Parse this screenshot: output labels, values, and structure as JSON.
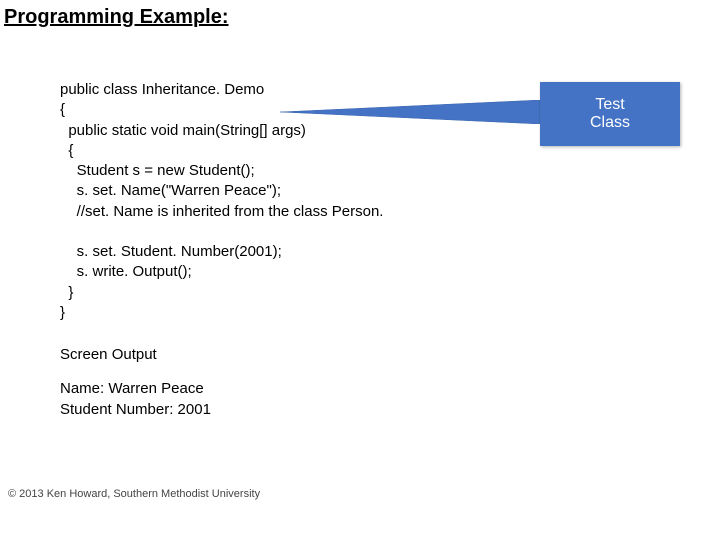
{
  "title": "Programming Example:",
  "code": {
    "l1": "public class Inheritance. Demo",
    "l2": "{",
    "l3": "  public static void main(String[] args)",
    "l4": "  {",
    "l5": "    Student s = new Student();",
    "l6": "    s. set. Name(\"Warren Peace\");",
    "l7": "    //set. Name is inherited from the class Person.",
    "l8": "",
    "l9": "    s. set. Student. Number(2001);",
    "l10": "    s. write. Output();",
    "l11": "  }",
    "l12": "}"
  },
  "screen_output": {
    "heading": "Screen Output",
    "line1": "Name: Warren Peace",
    "line2": "Student Number: 2001"
  },
  "callout": {
    "line1": "Test",
    "line2": "Class",
    "fill": "#4473c5"
  },
  "footer": "© 2013 Ken Howard, Southern Methodist University"
}
